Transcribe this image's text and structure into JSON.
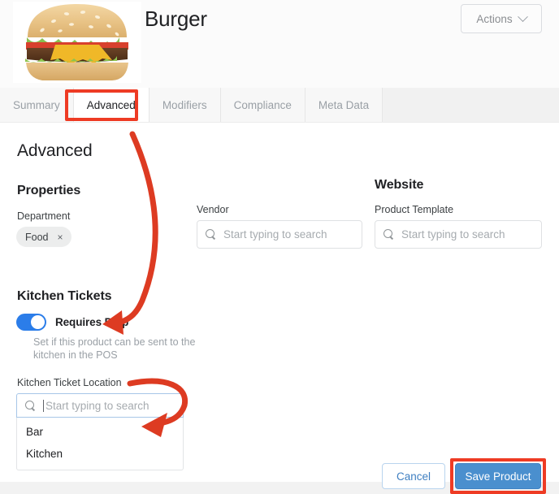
{
  "header": {
    "product_title": "Burger",
    "product_image_alt": "cheeseburger-photo",
    "actions_label": "Actions"
  },
  "tabs": [
    {
      "label": "Summary",
      "active": false
    },
    {
      "label": "Advanced",
      "active": true
    },
    {
      "label": "Modifiers",
      "active": false
    },
    {
      "label": "Compliance",
      "active": false
    },
    {
      "label": "Meta Data",
      "active": false
    }
  ],
  "page": {
    "heading": "Advanced"
  },
  "properties": {
    "section_title": "Properties",
    "department": {
      "label": "Department",
      "chips": [
        {
          "text": "Food",
          "remove": "×"
        }
      ]
    }
  },
  "vendor": {
    "label": "Vendor",
    "value": "",
    "placeholder": "Start typing to search"
  },
  "website": {
    "section_title": "Website",
    "product_template": {
      "label": "Product Template",
      "value": "",
      "placeholder": "Start typing to search"
    }
  },
  "kitchen_tickets": {
    "section_title": "Kitchen Tickets",
    "requires_prep": {
      "label": "Requires Prep",
      "enabled": true,
      "helper_text": "Set if this product can be sent to the kitchen in the POS"
    },
    "ticket_location": {
      "label": "Kitchen Ticket Location",
      "value": "",
      "placeholder": "Start typing to search",
      "dropdown_open": true,
      "options": [
        "Bar",
        "Kitchen"
      ]
    }
  },
  "footer": {
    "cancel_label": "Cancel",
    "save_label": "Save Product"
  },
  "annotations": {
    "highlight_color": "#ee3b24",
    "arrow_color": "#dd3b22",
    "highlighted_elements": [
      "Advanced",
      "Save Product"
    ],
    "arrows": [
      {
        "from": "Advanced tab",
        "to": "Requires Prep toggle"
      },
      {
        "from": "Kitchen Ticket Location label",
        "to": "dropdown options"
      }
    ]
  },
  "colors": {
    "toggle_on": "#2b7de9",
    "primary_button": "#4a8fce",
    "link": "#3f7fc1",
    "chip_bg": "#eceded",
    "focus_border": "#a7c6e8"
  }
}
